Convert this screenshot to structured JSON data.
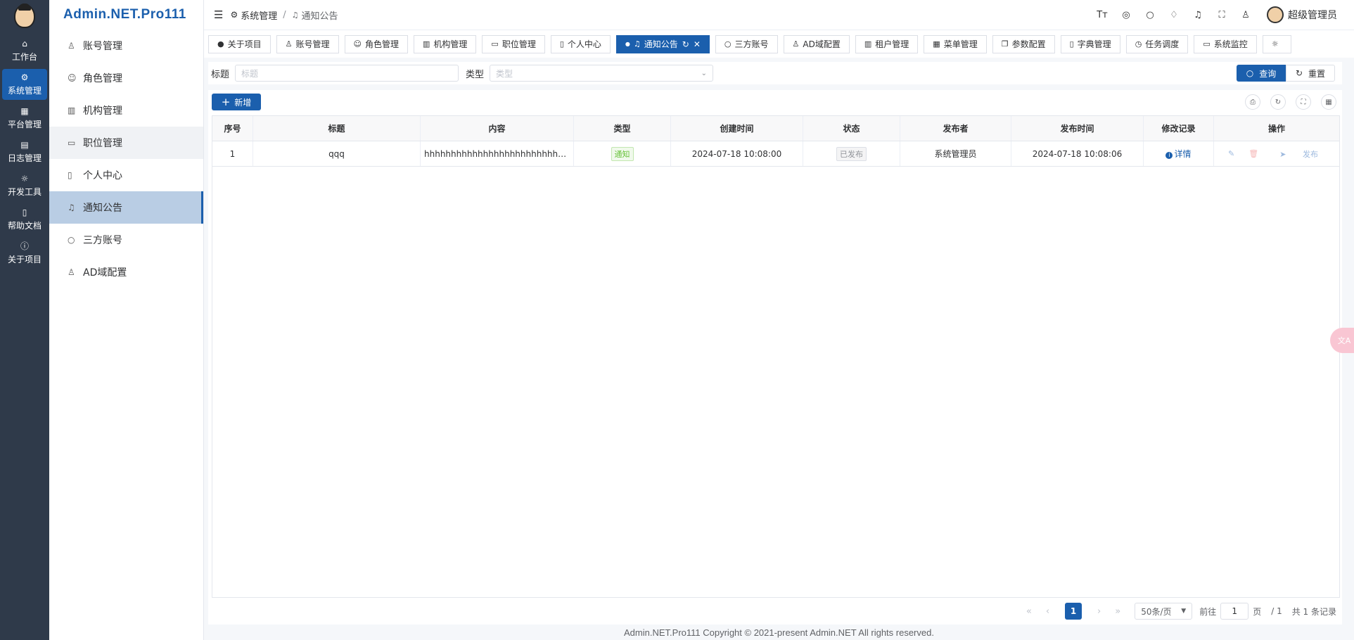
{
  "rail": {
    "items": [
      {
        "icon": "home-icon",
        "label": "工作台"
      },
      {
        "icon": "gear-icon",
        "label": "系统管理"
      },
      {
        "icon": "grid-icon",
        "label": "平台管理"
      },
      {
        "icon": "document-icon",
        "label": "日志管理"
      },
      {
        "icon": "sun-icon",
        "label": "开发工具"
      },
      {
        "icon": "book-icon",
        "label": "帮助文档"
      },
      {
        "icon": "info-icon",
        "label": "关于项目"
      }
    ]
  },
  "sidebar": {
    "brand": "Admin.NET.Pro111",
    "items": [
      {
        "icon": "user-icon",
        "label": "账号管理"
      },
      {
        "icon": "smile-icon",
        "label": "角色管理"
      },
      {
        "icon": "building-icon",
        "label": "机构管理"
      },
      {
        "icon": "tag-icon",
        "label": "职位管理"
      },
      {
        "icon": "badge-icon",
        "label": "个人中心"
      },
      {
        "icon": "bell-icon",
        "label": "通知公告"
      },
      {
        "icon": "chat-icon",
        "label": "三方账号"
      },
      {
        "icon": "user-icon",
        "label": "AD域配置"
      }
    ]
  },
  "header": {
    "breadcrumb": [
      "系统管理",
      "通知公告"
    ],
    "username": "超级管理员",
    "tool_icons": [
      "font-size-icon",
      "target-icon",
      "search-icon",
      "shirt-icon",
      "bell-icon",
      "fullscreen-icon",
      "user-icon"
    ]
  },
  "tabs": [
    {
      "icon": "info-icon",
      "label": "关于项目"
    },
    {
      "icon": "user-icon",
      "label": "账号管理"
    },
    {
      "icon": "smile-icon",
      "label": "角色管理"
    },
    {
      "icon": "building-icon",
      "label": "机构管理"
    },
    {
      "icon": "tag-icon",
      "label": "职位管理"
    },
    {
      "icon": "badge-icon",
      "label": "个人中心"
    },
    {
      "icon": "bell-icon",
      "label": "通知公告"
    },
    {
      "icon": "chat-icon",
      "label": "三方账号"
    },
    {
      "icon": "user-icon",
      "label": "AD域配置"
    },
    {
      "icon": "building-icon",
      "label": "租户管理"
    },
    {
      "icon": "grid-icon",
      "label": "菜单管理"
    },
    {
      "icon": "copy-icon",
      "label": "参数配置"
    },
    {
      "icon": "book-icon",
      "label": "字典管理"
    },
    {
      "icon": "alarm-icon",
      "label": "任务调度"
    },
    {
      "icon": "monitor-icon",
      "label": "系统监控"
    }
  ],
  "search": {
    "title_label": "标题",
    "title_placeholder": "标题",
    "type_label": "类型",
    "type_placeholder": "类型",
    "query_label": "查询",
    "reset_label": "重置"
  },
  "toolbar": {
    "add_label": "新增"
  },
  "table": {
    "columns": [
      "序号",
      "标题",
      "内容",
      "类型",
      "创建时间",
      "状态",
      "发布者",
      "发布时间",
      "修改记录",
      "操作"
    ],
    "rows": [
      {
        "index": "1",
        "title": "qqq",
        "content": "hhhhhhhhhhhhhhhhhhhhhhhhhhhhhhhhhhhhhhhhhhhh",
        "type": "通知",
        "created": "2024-07-18 10:08:00",
        "status": "已发布",
        "publisher": "系统管理员",
        "published": "2024-07-18 10:08:06",
        "history": "详情",
        "publish_action": "发布"
      }
    ]
  },
  "pager": {
    "current": "1",
    "page_size": "50条/页",
    "goto_label": "前往",
    "goto_value": "1",
    "page_unit": "页",
    "total_pages": "/ 1",
    "total": "共 1 条记录"
  },
  "footer": "Admin.NET.Pro111 Copyright © 2021-present Admin.NET All rights reserved.",
  "accent_color": "#1b5fad"
}
